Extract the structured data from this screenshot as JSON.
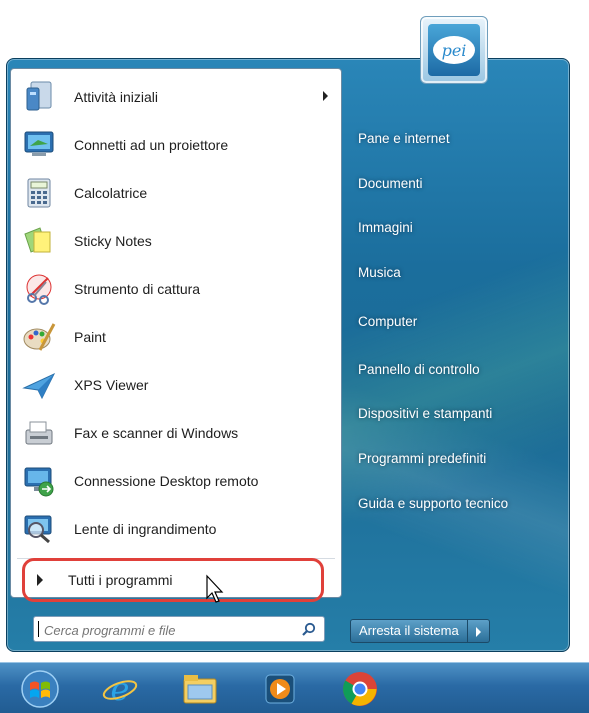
{
  "left_pane": {
    "items": [
      {
        "label": "Attività iniziali",
        "icon": "getting-started-icon",
        "has_submenu": true
      },
      {
        "label": "Connetti ad un proiettore",
        "icon": "projector-icon",
        "has_submenu": false
      },
      {
        "label": "Calcolatrice",
        "icon": "calculator-icon",
        "has_submenu": false
      },
      {
        "label": "Sticky Notes",
        "icon": "sticky-notes-icon",
        "has_submenu": false
      },
      {
        "label": "Strumento di cattura",
        "icon": "snipping-tool-icon",
        "has_submenu": false
      },
      {
        "label": "Paint",
        "icon": "paint-palette-icon",
        "has_submenu": false
      },
      {
        "label": "XPS Viewer",
        "icon": "xps-viewer-icon",
        "has_submenu": false
      },
      {
        "label": "Fax e scanner di Windows",
        "icon": "fax-scanner-icon",
        "has_submenu": false
      },
      {
        "label": "Connessione Desktop remoto",
        "icon": "remote-desktop-icon",
        "has_submenu": false
      },
      {
        "label": "Lente di ingrandimento",
        "icon": "magnifier-icon",
        "has_submenu": false
      }
    ],
    "all_programs": "Tutti i programmi",
    "search_placeholder": "Cerca programmi e file"
  },
  "right_pane": {
    "user_picture_text": "pei",
    "items": [
      {
        "label": "Pane e internet"
      },
      {
        "label": "Documenti"
      },
      {
        "label": "Immagini"
      },
      {
        "label": "Musica"
      },
      {
        "label": "Computer"
      },
      {
        "label": "Pannello di controllo"
      },
      {
        "label": "Dispositivi e stampanti"
      },
      {
        "label": "Programmi predefiniti"
      },
      {
        "label": "Guida e supporto tecnico"
      }
    ],
    "shutdown_label": "Arresta il sistema"
  },
  "taskbar": {
    "items": [
      {
        "icon": "windows-start-orb-icon"
      },
      {
        "icon": "internet-explorer-icon"
      },
      {
        "icon": "file-explorer-icon"
      },
      {
        "icon": "media-player-icon"
      },
      {
        "icon": "chrome-icon"
      }
    ]
  },
  "colors": {
    "highlight_ring": "#e0403a",
    "menu_glass": "#1b6e9d"
  }
}
